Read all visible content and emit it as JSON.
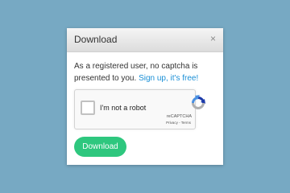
{
  "modal": {
    "title": "Download",
    "close_label": "×",
    "message_text": "As a registered user, no captcha is presented to you.",
    "signup_link": "Sign up, it's free!"
  },
  "captcha": {
    "checkbox_label": "I'm not a robot",
    "brand": "reCAPTCHA",
    "privacy_label": "Privacy",
    "separator": " - ",
    "terms_label": "Terms",
    "logo_icon": "recaptcha-logo-icon"
  },
  "actions": {
    "download_label": "Download"
  },
  "colors": {
    "background": "#77a9c3",
    "link": "#1a8fd6",
    "primary_button": "#2ec77e",
    "recaptcha_blue": "#1c3aa9",
    "recaptcha_lightblue": "#4a90e2",
    "recaptcha_gray": "#b0b0b0"
  }
}
